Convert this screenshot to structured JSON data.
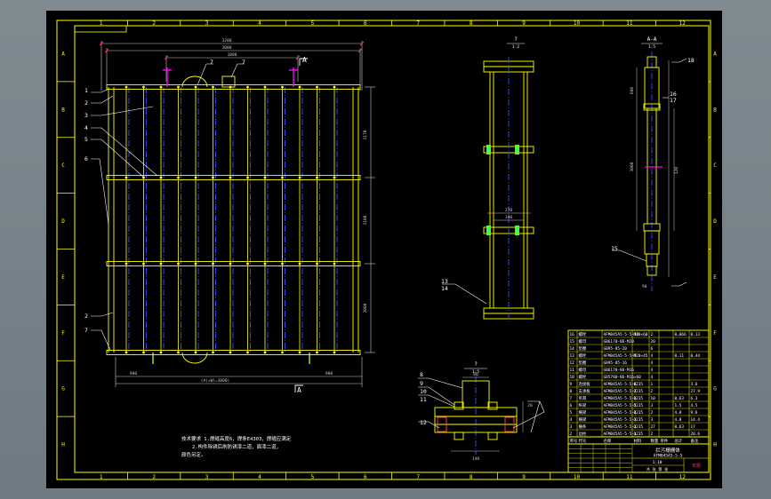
{
  "colors": {
    "background": "#000000",
    "viewport": "#7b858c",
    "frame": "#ffff00",
    "member": "#ffff00",
    "center_line": "#3a4cff",
    "dimension": "#c8c8c8",
    "tick": "#ff3060",
    "leader": "#ffffff",
    "magenta": "#ff00ff",
    "green": "#40ff40"
  },
  "border": {
    "columns": [
      "1",
      "2",
      "3",
      "4",
      "5",
      "6",
      "7",
      "8",
      "9",
      "10",
      "11",
      "12"
    ],
    "rows": [
      "A",
      "B",
      "C",
      "D",
      "E",
      "F",
      "G",
      "H"
    ]
  },
  "front_view": {
    "top_dims": [
      "3280",
      "3000",
      "1800"
    ],
    "right_dims": [
      "2170",
      "2100",
      "2000"
    ],
    "bottom_dims": [
      "900",
      "900",
      "(A)×W(=3000)"
    ],
    "left_labels": [
      "1",
      "2",
      "3",
      "4",
      "5",
      "6",
      "2",
      "7"
    ],
    "top_labels": [
      "7",
      "7"
    ],
    "section_mark": "A",
    "section_mark_bottom": "A"
  },
  "side_view": {
    "title": "?",
    "scale": "1:2",
    "dims": [
      "270",
      "190"
    ],
    "labels": [
      "13",
      "14"
    ]
  },
  "section_view": {
    "title": "A-A",
    "scale": "1:5",
    "labels": [
      "15",
      "16",
      "17",
      "18"
    ],
    "dims": [
      "600",
      "3000",
      "120",
      "90"
    ]
  },
  "detail_view": {
    "title": "?",
    "scale": "1:5",
    "labels": [
      "8",
      "9",
      "10",
      "11",
      "12"
    ],
    "dims": [
      "80",
      "140",
      "20"
    ]
  },
  "notes": [
    "技术要求 1.焊缝高度6，焊条E4303，焊缝应满足",
    "2.构件除锈后刷防锈漆二道，面漆二道，",
    "颜色另定。"
  ],
  "bom": {
    "rows": [
      [
        "16",
        "螺栓",
        "AFM045A5-5-5-10",
        "M20×60",
        "2",
        "",
        "0.066",
        "0.13"
      ],
      [
        "15",
        "螺母",
        "GB6170-86-M20",
        "",
        "20",
        "",
        "",
        ""
      ],
      [
        "14",
        "垫圈",
        "GB95-85-20",
        "",
        "6",
        "",
        "",
        ""
      ],
      [
        "13",
        "螺栓",
        "AFM045A5-5-5-9",
        "M20×45",
        "4",
        "",
        "0.11",
        "0.44"
      ],
      [
        "12",
        "垫圈",
        "GB95-85-16",
        "",
        "4",
        "",
        "",
        ""
      ],
      [
        "11",
        "螺母",
        "GB6170-86-M16",
        "",
        "4",
        "",
        "",
        ""
      ],
      [
        "10",
        "螺栓",
        "GB5780-86-M16×60",
        "",
        "4",
        "",
        "",
        ""
      ],
      [
        "9",
        "连接板",
        "AFM045A5-5-5-8",
        "Q235",
        "1",
        "",
        "",
        "3.6"
      ],
      [
        "8",
        "支承板",
        "AFM045A5-5-5-7",
        "Q235",
        "2",
        "",
        "",
        "27.9"
      ],
      [
        "7",
        "吊耳",
        "AFM045A5-5-5-6",
        "Q235",
        "10",
        "",
        "0.63",
        "6.3"
      ],
      [
        "6",
        "纵梁",
        "AFM045A5-5-5-5",
        "Q235",
        "3",
        "",
        "1.5",
        "4.5"
      ],
      [
        "5",
        "横梁",
        "AFM045A5-5-5-4",
        "Q235",
        "2",
        "",
        "4.8",
        "9.6"
      ],
      [
        "4",
        "横梁",
        "AFM045A5-5-5-3",
        "Q235",
        "3",
        "",
        "4.8",
        "14.4"
      ],
      [
        "3",
        "栅条",
        "AFM045A5-5-5-2",
        "Q235",
        "27",
        "",
        "0.63",
        "17"
      ],
      [
        "2",
        "边柱",
        "AFM045A5-5-5-1",
        "Q235",
        "2",
        "",
        "",
        "20.6"
      ]
    ],
    "header": [
      "序号",
      "代号",
      "名称",
      "材料",
      "数量",
      "单件",
      "总计",
      "备注"
    ],
    "drawing_title": "拦污栅栅体",
    "drawing_number": "AFM045A5-5-5",
    "scale": "1:10",
    "sheet_info": "共 张 第 张",
    "company": "安顺"
  }
}
